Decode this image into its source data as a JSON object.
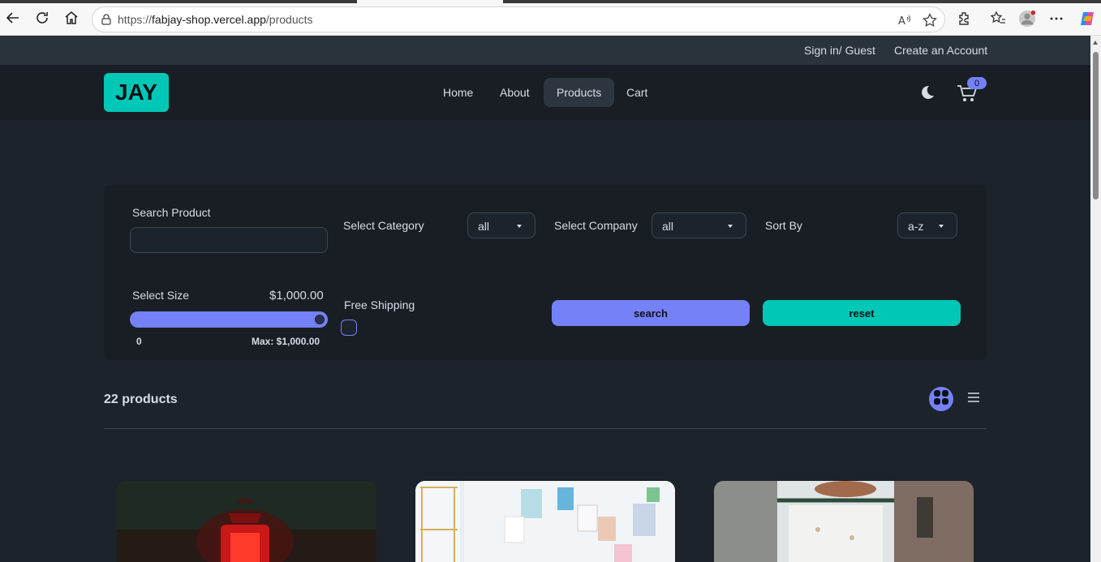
{
  "browser": {
    "url_prefix": "https://",
    "url_host": "fabjay-shop.vercel.app",
    "url_path": "/products"
  },
  "topbar": {
    "signin": "Sign in/ Guest",
    "create_account": "Create an Account"
  },
  "navbar": {
    "logo": "JAY",
    "links": [
      "Home",
      "About",
      "Products",
      "Cart"
    ],
    "active_link": "Products",
    "cart_count": "0"
  },
  "filters": {
    "search_label": "Search Product",
    "search_value": "",
    "category_label": "Select Category",
    "category_value": "all",
    "company_label": "Select Company",
    "company_value": "all",
    "sort_label": "Sort By",
    "sort_value": "a-z",
    "size_label": "Select Size",
    "price_value": "$1,000.00",
    "price_level": 1.0,
    "range_min": "0",
    "range_max": "Max: $1,000.00",
    "shipping_label": "Free Shipping",
    "shipping_checked": false,
    "search_button": "search",
    "reset_button": "reset"
  },
  "products": {
    "count_label": "22 products",
    "layout": "grid"
  },
  "colors": {
    "primary": "#7581f7",
    "secondary": "#00c7b6",
    "background": "#1d232a"
  }
}
